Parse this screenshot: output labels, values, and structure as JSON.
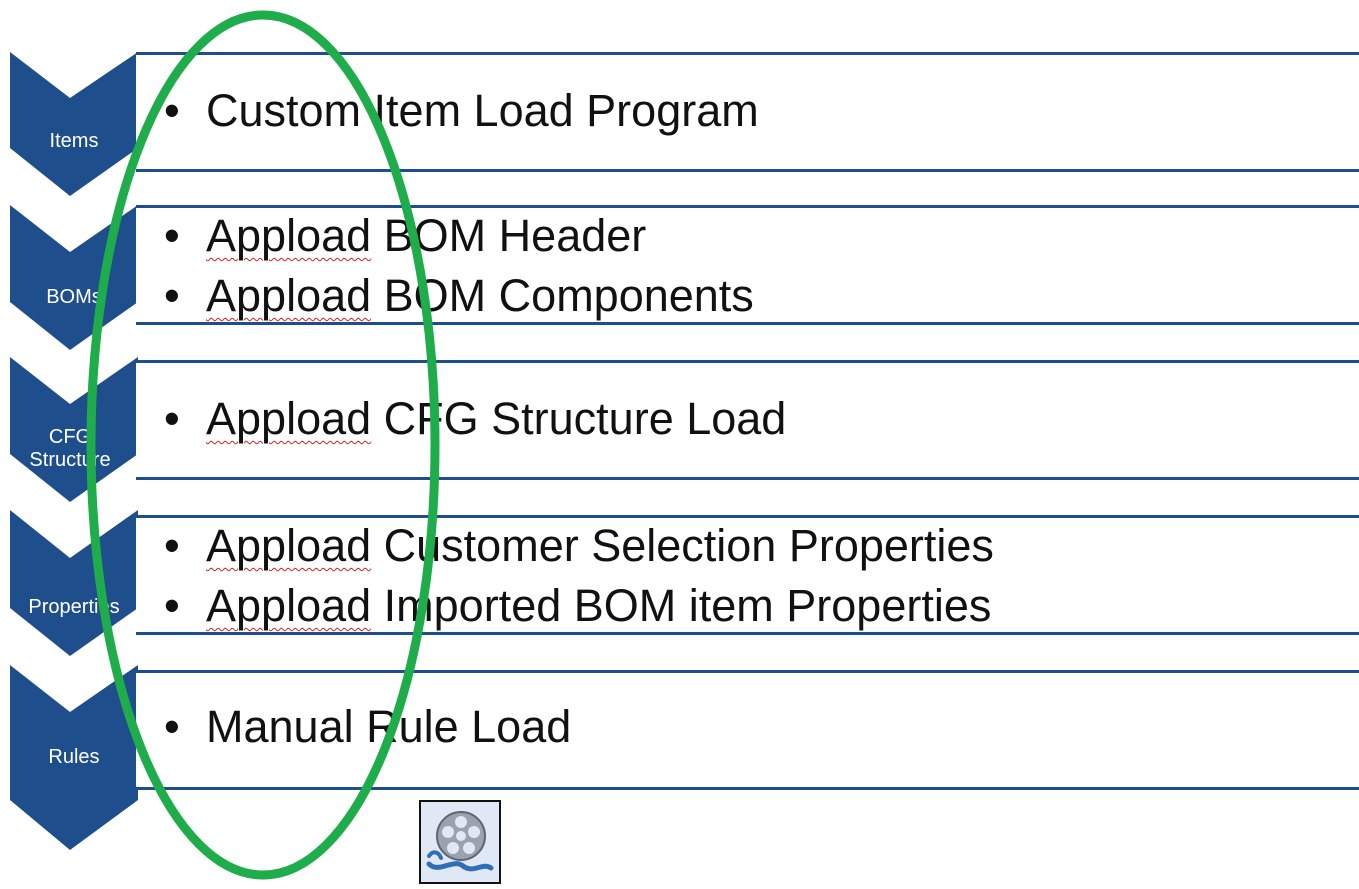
{
  "stages": [
    {
      "label": "Items",
      "bullets": [
        {
          "prefix": "",
          "text": "Custom Item Load Program"
        }
      ]
    },
    {
      "label": "BOMs",
      "bullets": [
        {
          "prefix": "Appload",
          "text": " BOM Header"
        },
        {
          "prefix": "Appload",
          "text": " BOM Components"
        }
      ]
    },
    {
      "label": "CFG Structure",
      "bullets": [
        {
          "prefix": "Appload",
          "text": " CFG Structure Load"
        }
      ]
    },
    {
      "label": "Properties",
      "bullets": [
        {
          "prefix": "Appload",
          "text": " Customer Selection Properties"
        },
        {
          "prefix": "Appload",
          "text": " Imported BOM item Properties"
        }
      ]
    },
    {
      "label": "Rules",
      "bullets": [
        {
          "prefix": "",
          "text": "Manual Rule Load"
        }
      ]
    }
  ],
  "colors": {
    "chevron": "#1f4e8c",
    "panel_border": "#1f4e8c",
    "ellipse": "#1fad4b",
    "spellcheck": "#d22020"
  },
  "icons": {
    "bullet": "•",
    "media": "film-reel-icon"
  }
}
